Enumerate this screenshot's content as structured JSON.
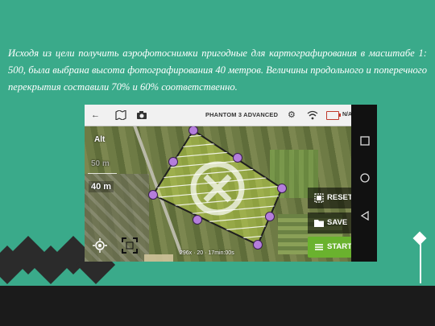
{
  "slide": {
    "text": "Исходя из цели получить аэрофотоснимки пригодные для картографирования в масштабе 1: 500, была выбрана высота фотографирования 40 метров. Величины продольного и поперечного перекрытия составили 70% и 60% соответственно."
  },
  "app": {
    "model": "PHANTOM 3 ADVANCED",
    "signal": "N/A",
    "alt_label": "Alt",
    "alt_ticks": [
      "50 m",
      "40 m"
    ],
    "buttons": {
      "reset": "RESET",
      "save": "SAVE",
      "start": "START"
    },
    "info": "296x · 20 · 17min:00s"
  },
  "colors": {
    "slide_bg": "#3aaa8a",
    "polygon_fill": "#c8e04a",
    "vertex": "#b57edc",
    "start": "#6ab22e"
  },
  "icons": [
    "back-arrow-icon",
    "map-icon",
    "camera-icon",
    "gear-icon",
    "wifi-icon",
    "battery-icon",
    "location-icon",
    "frame-icon",
    "square-nav-icon",
    "circle-nav-icon",
    "back-triangle-nav-icon"
  ]
}
